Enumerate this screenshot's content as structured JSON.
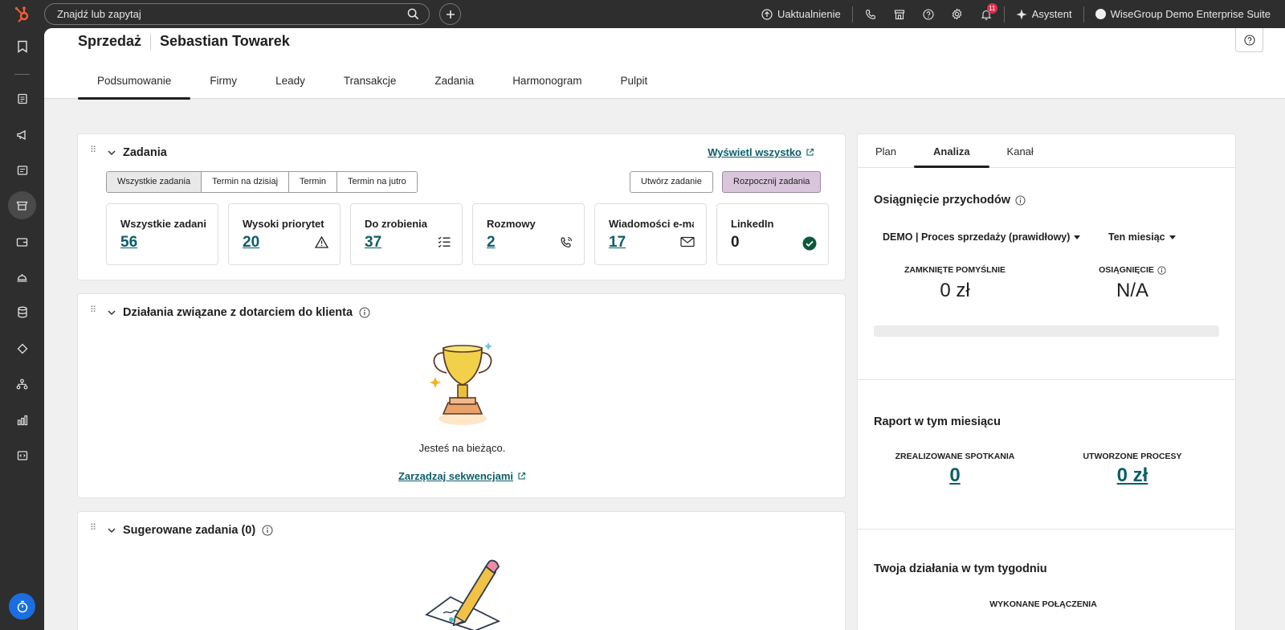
{
  "topbar": {
    "search_placeholder": "Znajdź lub zapytaj",
    "upgrade_label": "Uaktualnienie",
    "notifications_count": "11",
    "assistant_label": "Asystent",
    "account_label": "WiseGroup Demo Enterprise Suite"
  },
  "header": {
    "section": "Sprzedaż",
    "user": "Sebastian Towarek",
    "tabs": [
      "Podsumowanie",
      "Firmy",
      "Leady",
      "Transakcje",
      "Zadania",
      "Harmonogram",
      "Pulpit"
    ]
  },
  "tasks": {
    "title": "Zadania",
    "view_all": "Wyświetl wszystko",
    "filters": [
      "Wszystkie zadania",
      "Termin na dzisiaj",
      "Termin",
      "Termin na jutro"
    ],
    "create_label": "Utwórz zadanie",
    "start_label": "Rozpocznij zadania",
    "stats": [
      {
        "label": "Wszystkie zadania",
        "value": "56"
      },
      {
        "label": "Wysoki priorytet",
        "value": "20"
      },
      {
        "label": "Do zrobienia",
        "value": "37"
      },
      {
        "label": "Rozmowy",
        "value": "2"
      },
      {
        "label": "Wiadomości e-mail",
        "value": "17"
      },
      {
        "label": "LinkedIn",
        "value": "0"
      }
    ]
  },
  "outreach": {
    "title": "Działania związane z dotarciem do klienta",
    "message": "Jesteś na bieżąco.",
    "manage_link": "Zarządzaj sekwencjami"
  },
  "suggested": {
    "title": "Sugerowane zadania (0)"
  },
  "right_panel": {
    "tabs": [
      "Plan",
      "Analiza",
      "Kanał"
    ],
    "revenue": {
      "title": "Osiągnięcie przychodów",
      "pipeline": "DEMO | Proces sprzedaży (prawidłowy)",
      "period": "Ten miesiąc",
      "closed_label": "ZAMKNIĘTE POMYŚLNIE",
      "closed_value": "0 zł",
      "achievement_label": "OSIĄGNIĘCIE",
      "achievement_value": "N/A"
    },
    "report": {
      "title": "Raport w tym miesiącu",
      "meetings_label": "ZREALIZOWANE SPOTKANIA",
      "meetings_value": "0",
      "deals_label": "UTWORZONE PROCESY",
      "deals_value": "0 zł"
    },
    "week": {
      "title": "Twoja działania w tym tygodniu",
      "calls_label": "WYKONANE POŁĄCZENIA"
    }
  },
  "colors": {
    "accent_link": "#0b5e68",
    "primary_button": "#d9c6dc",
    "timer_button": "#1a6ee0",
    "hubspot_orange": "#ff5c35"
  }
}
